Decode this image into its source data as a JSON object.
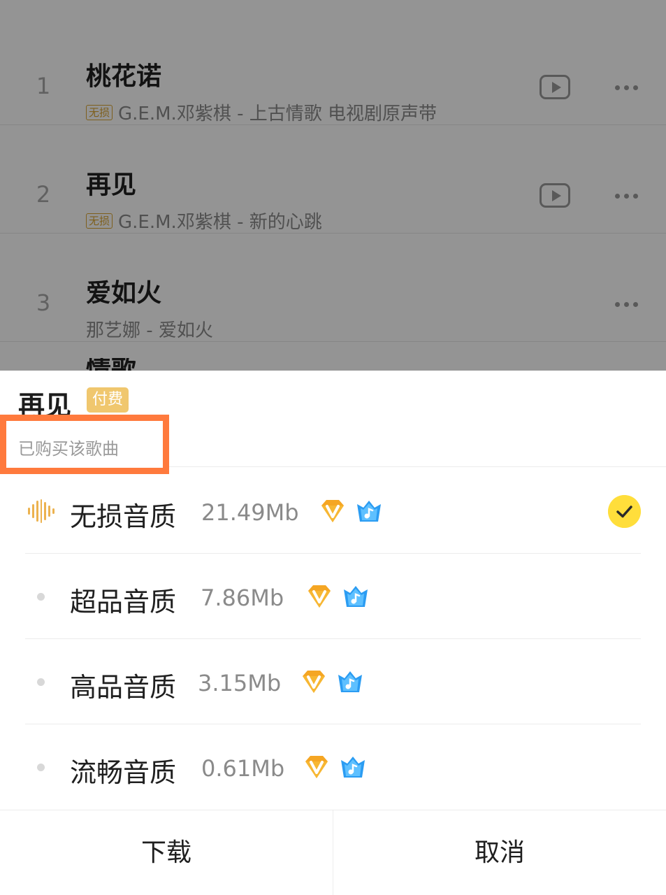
{
  "song_list": {
    "items": [
      {
        "index": "1",
        "title": "桃花诺",
        "tag": "无损",
        "subtitle": "G.E.M.邓紫棋 - 上古情歌 电视剧原声带",
        "has_mv": true
      },
      {
        "index": "2",
        "title": "再见",
        "tag": "无损",
        "subtitle": "G.E.M.邓紫棋 - 新的心跳",
        "has_mv": true
      },
      {
        "index": "3",
        "title": "爱如火",
        "tag": "",
        "subtitle": "那艺娜 - 爱如火",
        "has_mv": false
      }
    ],
    "next_peek_title": "情歌"
  },
  "sheet": {
    "title": "再见",
    "paid_badge": "付费",
    "purchased_text": "已购买该歌曲",
    "highlight_color": "#ff7a3d",
    "qualities": [
      {
        "label": "无损音质",
        "size": "21.49Mb",
        "selected": true,
        "icon": "waveform-icon",
        "badges": [
          "vip-diamond-icon",
          "music-package-icon"
        ]
      },
      {
        "label": "超品音质",
        "size": "7.86Mb",
        "selected": false,
        "icon": "dot-icon",
        "badges": [
          "vip-diamond-icon",
          "music-package-icon"
        ]
      },
      {
        "label": "高品音质",
        "size": "3.15Mb",
        "selected": false,
        "icon": "dot-icon",
        "badges": [
          "vip-diamond-icon",
          "music-package-icon"
        ]
      },
      {
        "label": "流畅音质",
        "size": "0.61Mb",
        "selected": false,
        "icon": "dot-icon",
        "badges": [
          "vip-diamond-icon",
          "music-package-icon"
        ]
      }
    ],
    "download_label": "下载",
    "cancel_label": "取消"
  },
  "colors": {
    "accent_yellow": "#ffde3b",
    "paid_badge_bg": "#f0c76e",
    "vip_gold": "#f5a623",
    "music_blue": "#2b9cf2"
  }
}
